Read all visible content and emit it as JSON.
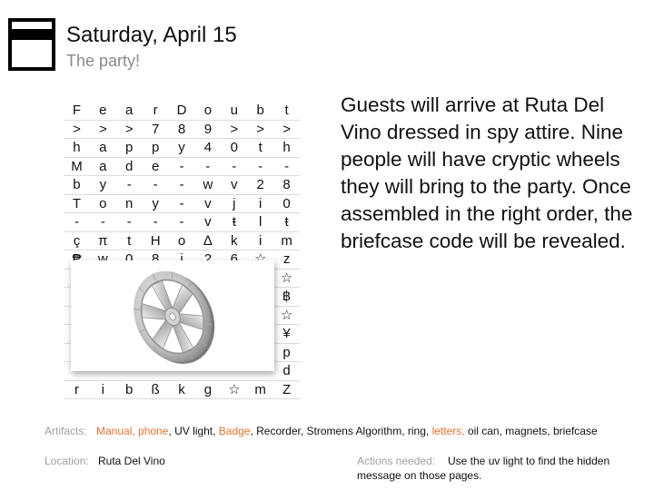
{
  "header": {
    "title": "Saturday, April 15",
    "subtitle": "The party!",
    "icon": "calendar-icon"
  },
  "grid": [
    [
      "F",
      "e",
      "a",
      "r",
      "D",
      "o",
      "u",
      "b",
      "t"
    ],
    [
      ">",
      ">",
      ">",
      "7",
      "8",
      "9",
      ">",
      ">",
      ">"
    ],
    [
      "h",
      "a",
      "p",
      "p",
      "y",
      "4",
      "0",
      "t",
      "h"
    ],
    [
      "M",
      "a",
      "d",
      "e",
      "-",
      "-",
      "-",
      "-",
      "-"
    ],
    [
      "b",
      "y",
      "-",
      "-",
      "-",
      "w",
      "v",
      "2",
      "8"
    ],
    [
      "T",
      "o",
      "n",
      "y",
      "-",
      "v",
      "j",
      "i",
      "0"
    ],
    [
      "-",
      "-",
      "-",
      "-",
      "-",
      "v",
      "ŧ",
      "l",
      "ŧ"
    ],
    [
      "ç",
      "π",
      "t",
      "H",
      "o",
      "∆",
      "k",
      "i",
      "m"
    ],
    [
      "₱",
      "w",
      "0",
      "8",
      "i",
      "2",
      "6",
      "☆",
      "z"
    ],
    [
      "",
      "",
      "",
      "",
      "",
      "",
      "",
      "",
      "☆"
    ],
    [
      "",
      "",
      "",
      "",
      "",
      "",
      "",
      "",
      "฿"
    ],
    [
      "",
      "",
      "",
      "",
      "",
      "",
      "",
      "",
      "☆"
    ],
    [
      "",
      "",
      "",
      "",
      "",
      "",
      "",
      "",
      "¥"
    ],
    [
      "",
      "",
      "",
      "",
      "",
      "",
      "",
      "",
      "p"
    ],
    [
      "",
      "",
      "",
      "",
      "",
      "",
      "",
      "",
      "d"
    ],
    [
      "r",
      "i",
      "b",
      "ß",
      "k",
      "g",
      "☆",
      "m",
      "Z"
    ]
  ],
  "photo": {
    "subject": "cipher-wheel"
  },
  "description": "Guests will arrive at Ruta Del Vino dressed in spy attire.  Nine people will have cryptic wheels they will bring to the party.  Once assembled in the right order, the briefcase code will be revealed.",
  "artifacts": {
    "label": "Artifacts:",
    "items": [
      {
        "text": "Manual, phone",
        "highlight": true
      },
      {
        "text": ", UV light, ",
        "highlight": false
      },
      {
        "text": "Badge",
        "highlight": true
      },
      {
        "text": ", Recorder, Stromens Algorithm, ring, ",
        "highlight": false
      },
      {
        "text": "letters,",
        "highlight": true
      },
      {
        "text": " oil can, magnets, briefcase",
        "highlight": false
      }
    ]
  },
  "location": {
    "label": "Location:",
    "value": "Ruta Del Vino"
  },
  "actions": {
    "label": "Actions needed:",
    "value": "Use the uv light to find the hidden message on those pages."
  },
  "colors": {
    "highlight": "#e8732a",
    "label_gray": "#a0a0a0",
    "subtitle_gray": "#8a8a8a"
  }
}
